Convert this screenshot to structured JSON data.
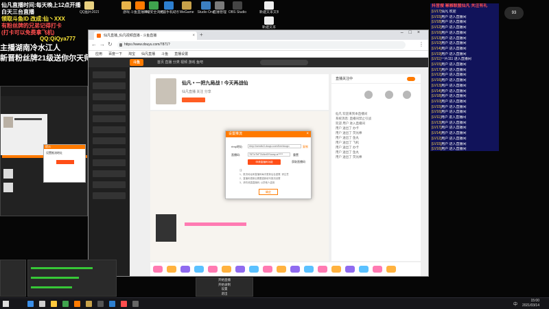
{
  "desktop_icons": [
    {
      "label": "QQ图片20210305...",
      "color": "#e8d080"
    },
    {
      "label": "游戏",
      "color": "#e9b34a"
    },
    {
      "label": "斗鱼直播伴侣",
      "color": "#ff7a00"
    },
    {
      "label": "360安全浏览器",
      "color": "#3fa34d"
    },
    {
      "label": "大疆手机助手",
      "color": "#2d7fd0"
    },
    {
      "label": "WeGame",
      "color": "#c8a24a"
    },
    {
      "label": "Studio One",
      "color": "#3c7fc1"
    },
    {
      "label": "直播管理",
      "color": "#7a7a7a"
    },
    {
      "label": "OBS Studio",
      "color": "#444444"
    },
    {
      "label": "新建文本文档",
      "color": "#eeeeee"
    },
    {
      "label": "新建文本",
      "color": "#eeeeee"
    }
  ],
  "overlay": {
    "line1": "仙凡直播时间:每天晚上12点开播",
    "line2": "白天三台直播",
    "line3": "领取斗鱼ID 改成:仙丶XXX",
    "line4": "有粉丝牌的兄弟记得打卡",
    "line5": "(打卡可以免费拿飞机)",
    "qq": "QQ:QiQya777",
    "big1": "主播湖南冷水江人",
    "big2": "新晋粉丝牌21级送你尔天师",
    "top_right": "抖音搜 幂雅联盟仙凡 关注有礼"
  },
  "browser": {
    "tab_title": "仙凡直播_仙凡视频直播 - 斗鱼直播",
    "url": "https://www.douyu.com/7871?",
    "bookmarks": [
      "应用",
      "百度一下",
      "淘宝",
      "仙凡直播",
      "斗鱼",
      "直播设置"
    ],
    "site_nav": "首页   直播   分类   视频   游戏   鱼吧",
    "room_title": "仙凡 • 一把九局战 ! 今天再战仙",
    "room_sub": "仙凡直播  关注  分享",
    "room_status": "直播关注中",
    "chat_lines": [
      "仙凡 欢迎来到本直播间",
      "系统消息: 直播间禁止引战",
      "欢迎 用户 进入直播间",
      "用户 送出了 办卡",
      "用户 送出了 荧光棒",
      "用户 送出了 鱼丸",
      "用户 送出了 飞机",
      "用户 送出了 办卡",
      "用户 送出了 鱼丸",
      "用户 送出了 荧光棒"
    ],
    "gift_colors": [
      "#ff7ab2",
      "#ffb23f",
      "#8f6bf0",
      "#5ac1ff",
      "#ff7ab2",
      "#ffb23f",
      "#8f6bf0",
      "#5ac1ff",
      "#ff7ab2",
      "#ffb23f",
      "#8f6bf0",
      "#5ac1ff",
      "#ff7ab2",
      "#ffb23f",
      "#8f6bf0",
      "#5ac1ff",
      "#ff7ab2",
      "#ffb23f"
    ]
  },
  "dialog": {
    "title": "设置推流",
    "label_server": "rtmp地址:",
    "server_value": "rtmp://sendtc3.douyu.com/live/douyu",
    "copy_label": "复制",
    "label_key": "直播码:",
    "key_value": "7871r7hF7A/Avl0Y/usrq=a*****",
    "reset_label": "重置",
    "get_label": "获取直播码",
    "get_button": "申请直播码功能",
    "notes": [
      "注:",
      "1、推流地址和直播码每次更新后会重置, 请注意",
      "2、直播码更新后需要重新填写推流设置",
      "3、请勿泄露直播码, 以防他人盗用"
    ],
    "confirm": "确定"
  },
  "chat_overlay": [
    {
      "lv": "[LV17]",
      "text": "仙凡 欢迎"
    },
    {
      "lv": "[LV15]",
      "text": "用户 进入直播间"
    },
    {
      "lv": "[LV18]",
      "text": "用户 进入直播间"
    },
    {
      "lv": "[LV12]",
      "text": "用户 进入直播间"
    },
    {
      "lv": "[LV16]",
      "text": "用户 进入直播间"
    },
    {
      "lv": "[LV13]",
      "text": "用户 进入直播间"
    },
    {
      "lv": "[LV10]",
      "text": "用户 进入直播间"
    },
    {
      "lv": "[LV14]",
      "text": "用户 进入直播间"
    },
    {
      "lv": "[LV19]",
      "text": "用户 进入直播间"
    },
    {
      "lv": "[LV11]",
      "text": "一片111 进入直播间"
    },
    {
      "lv": "[LV15]",
      "text": "用户 进入直播间"
    },
    {
      "lv": "[LV17]",
      "text": "用户 进入直播间"
    },
    {
      "lv": "[LV12]",
      "text": "用户 进入直播间"
    },
    {
      "lv": "[LV16]",
      "text": "用户 进入直播间"
    },
    {
      "lv": "[LV13]",
      "text": "用户 进入直播间"
    },
    {
      "lv": "[LV14]",
      "text": "用户 进入直播间"
    },
    {
      "lv": "[LV18]",
      "text": "用户 进入直播间"
    },
    {
      "lv": "[LV10]",
      "text": "用户 进入直播间"
    },
    {
      "lv": "[LV15]",
      "text": "用户 进入直播间"
    },
    {
      "lv": "[LV16]",
      "text": "用户 进入直播间"
    },
    {
      "lv": "[LV11]",
      "text": "用户 进入直播间"
    },
    {
      "lv": "[LV13]",
      "text": "用户 进入直播间"
    },
    {
      "lv": "[LV17]",
      "text": "用户 进入直播间"
    },
    {
      "lv": "[LV14]",
      "text": "用户 进入直播间"
    },
    {
      "lv": "[LV12]",
      "text": "用户 进入直播间"
    },
    {
      "lv": "[LV15]",
      "text": "用户 进入直播间"
    },
    {
      "lv": "[LV16]",
      "text": "用户 进入直播间"
    },
    {
      "lv": "[LV10]",
      "text": "用户 进入直播间"
    }
  ],
  "gauge": "93",
  "popup": {
    "title": "提示",
    "line": "设置推流地址"
  },
  "obs_dock": {
    "labels": [
      "开始直播",
      "开始录制",
      "设置",
      "退出"
    ]
  },
  "taskbar": {
    "time": "15:00",
    "date": "2021/03/14",
    "lang": "中"
  }
}
